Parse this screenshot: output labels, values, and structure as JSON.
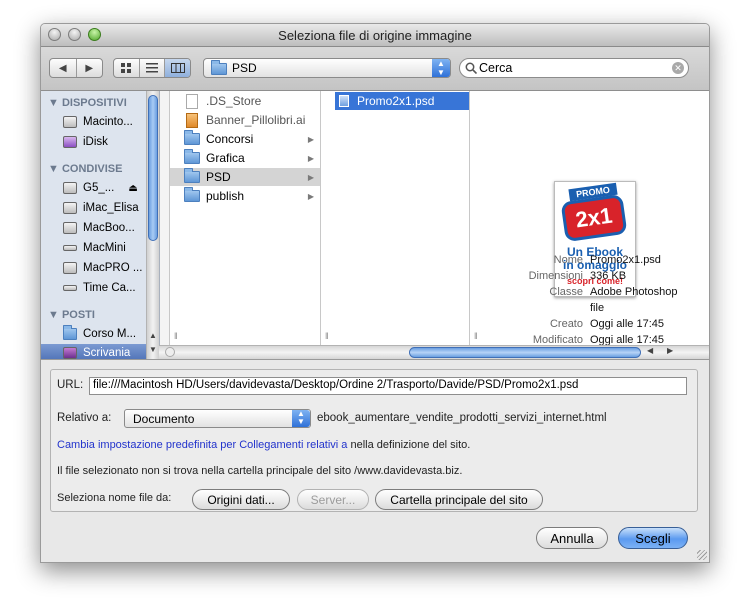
{
  "window": {
    "title": "Seleziona file di origine immagine"
  },
  "toolbar": {
    "location": "PSD",
    "search_value": "Cerca"
  },
  "sidebar": {
    "sections": [
      {
        "title": "DISPOSITIVI",
        "items": [
          "Macinto...",
          "iDisk"
        ]
      },
      {
        "title": "CONDIVISE",
        "items": [
          "G5_...",
          "iMac_Elisa",
          "MacBoo...",
          "MacMini",
          "MacPRO ...",
          "Time Ca..."
        ]
      },
      {
        "title": "POSTI",
        "items": [
          "Corso M...",
          "Scrivania"
        ]
      }
    ]
  },
  "columns": {
    "col1": [
      ".DS_Store",
      "Banner_Pillolibri.ai",
      "Concorsi",
      "Grafica",
      "PSD",
      "publish"
    ],
    "col2": [
      "Promo2x1.psd"
    ]
  },
  "preview": {
    "image_text": [
      "PROMO",
      "2x1",
      "Un Ebook",
      "in omaggio",
      "scopri come!"
    ],
    "meta": [
      {
        "label": "Nome",
        "value": "Promo2x1.psd"
      },
      {
        "label": "Dimensioni",
        "value": "336 KB"
      },
      {
        "label": "Classe",
        "value": "Adobe Photoshop"
      },
      {
        "label": "",
        "value": "file"
      },
      {
        "label": "Creato",
        "value": "Oggi alle 17:45"
      },
      {
        "label": "Modificato",
        "value": "Oggi alle 17:45"
      }
    ]
  },
  "options": {
    "url_label": "URL:",
    "url_value": "file:///Macintosh HD/Users/davidevasta/Desktop/Ordine 2/Trasporto/Davide/PSD/Promo2x1.psd",
    "relative_label": "Relativo a:",
    "relative_value": "Documento",
    "relative_doc": "ebook_aumentare_vendite_prodotti_servizi_internet.html",
    "link_text": "Cambia impostazione predefinita per Collegamenti relativi a",
    "link_suffix": "nella definizione del sito.",
    "info_text": "Il file selezionato non si trova nella cartella principale del sito /www.davidevasta.biz.",
    "select_label": "Seleziona nome file da:",
    "btn_data_sources": "Origini dati...",
    "btn_server": "Server...",
    "btn_site_root": "Cartella principale del sito"
  },
  "actions": {
    "cancel": "Annulla",
    "choose": "Scegli"
  },
  "colors": {
    "selection": "#3875d7",
    "sidebar_bg": "#dde4ee",
    "link": "#2233cc",
    "promo_blue": "#1a5fb0",
    "promo_red": "#d8232a"
  }
}
